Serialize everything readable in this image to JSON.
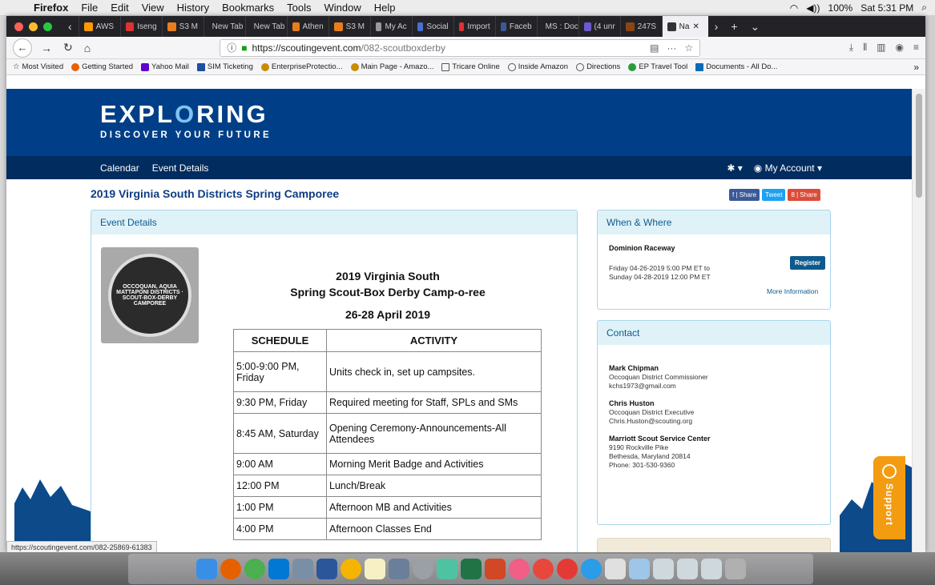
{
  "menubar": {
    "app": "Firefox",
    "menus": [
      "File",
      "Edit",
      "View",
      "History",
      "Bookmarks",
      "Tools",
      "Window",
      "Help"
    ],
    "battery": "100%",
    "clock": "Sat 5:31 PM"
  },
  "tabs": [
    {
      "label": "AWS",
      "color": "#f90"
    },
    {
      "label": "Iseng",
      "color": "#d33"
    },
    {
      "label": "S3 M",
      "color": "#e87d1e"
    },
    {
      "label": "New Tab",
      "color": "#555"
    },
    {
      "label": "New Tab",
      "color": "#555"
    },
    {
      "label": "Athen",
      "color": "#e87d1e"
    },
    {
      "label": "S3 M",
      "color": "#e87d1e"
    },
    {
      "label": "My Ac",
      "color": "#999"
    },
    {
      "label": "Social",
      "color": "#4a6fd1"
    },
    {
      "label": "Import",
      "color": "#d33"
    },
    {
      "label": "Faceb",
      "color": "#3b5998"
    },
    {
      "label": "MS : Docu",
      "color": "#2b5fb4"
    },
    {
      "label": "(4 unr",
      "color": "#6a5acd"
    },
    {
      "label": "247S",
      "color": "#8b4513"
    },
    {
      "label": "Na",
      "color": "#333",
      "active": true
    }
  ],
  "url": {
    "host": "https://scoutingevent.com",
    "path": "/082-scoutboxderby"
  },
  "bookmarks": [
    "Most Visited",
    "Getting Started",
    "Yahoo Mail",
    "SIM Ticketing",
    "EnterpriseProtectio...",
    "Main Page - Amazo...",
    "Tricare Online",
    "Inside Amazon",
    "Directions",
    "EP Travel Tool",
    "Documents - All Do..."
  ],
  "site": {
    "logo_pre": "EXPL",
    "logo_o": "O",
    "logo_post": "RING",
    "logo_tag": "DISCOVER YOUR FUTURE",
    "nav": [
      "Calendar",
      "Event Details"
    ],
    "account": "My Account"
  },
  "event": {
    "title": "2019 Virginia South Districts Spring Camporee",
    "share": [
      "f | Share",
      "Tweet",
      "8 | Share"
    ],
    "panel_title": "Event Details",
    "badge_text": "OCCOQUAN, AQUIA MATTAPONI DISTRICTS · SCOUT-BOX-DERBY CAMPOREE",
    "heading1": "2019 Virginia South",
    "heading2": "Spring Scout-Box Derby Camp-o-ree",
    "dates": "26-28 April 2019",
    "schedule_headers": [
      "SCHEDULE",
      "ACTIVITY"
    ],
    "schedule": [
      {
        "time": "5:00-9:00 PM, Friday",
        "activity": "Units check in, set up campsites."
      },
      {
        "time": "9:30 PM, Friday",
        "activity": "Required meeting for Staff, SPLs and SMs"
      },
      {
        "time": "8:45 AM, Saturday",
        "activity": "Opening Ceremony-Announcements-All Attendees"
      },
      {
        "time": "9:00 AM",
        "activity": "Morning Merit Badge and Activities"
      },
      {
        "time": "12:00 PM",
        "activity": "Lunch/Break"
      },
      {
        "time": "1:00 PM",
        "activity": "Afternoon MB and Activities"
      },
      {
        "time": "4:00 PM",
        "activity": "Afternoon Classes End"
      }
    ]
  },
  "when": {
    "title": "When & Where",
    "venue": "Dominion Raceway",
    "register": "Register",
    "from": "Friday 04-26-2019 5:00 PM ET to",
    "to": "Sunday 04-28-2019 12:00 PM ET",
    "more": "More Information"
  },
  "contact": {
    "title": "Contact",
    "people": [
      {
        "name": "Mark Chipman",
        "role": "Occoquan District Commissioner",
        "email": "kchs1973@gmail.com"
      },
      {
        "name": "Chris Huston",
        "role": "Occoquan District Executive",
        "email": "Chris.Huston@scouting.org"
      }
    ],
    "center": {
      "name": "Marriott Scout Service Center",
      "addr1": "9190 Rockville Pike",
      "addr2": "Bethesda, Maryland 20814",
      "phone": "Phone: 301-530-9360"
    }
  },
  "support": "Support",
  "status_url": "https://scoutingevent.com/082-25869-61383"
}
